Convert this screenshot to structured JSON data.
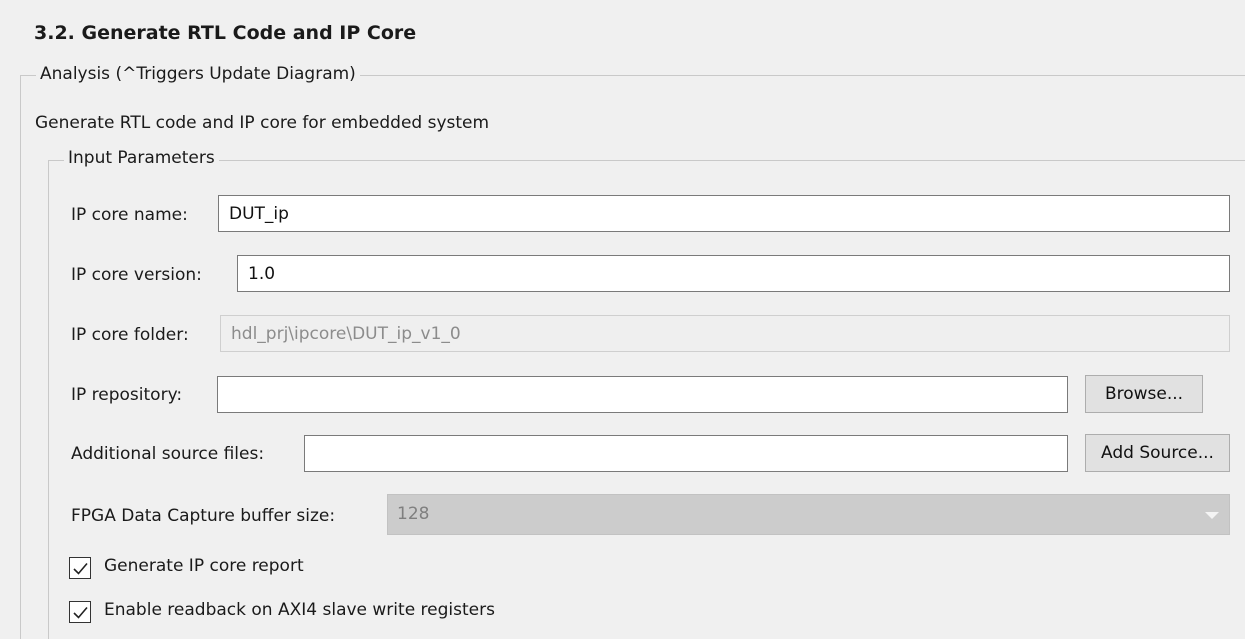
{
  "header": {
    "title": "3.2. Generate RTL Code and IP Core"
  },
  "analysis": {
    "legend": "Analysis (^Triggers Update Diagram)",
    "description": "Generate RTL code and IP core for embedded system"
  },
  "input_parameters": {
    "legend": "Input Parameters",
    "ip_core_name": {
      "label": "IP core name:",
      "value": "DUT_ip"
    },
    "ip_core_version": {
      "label": "IP core version:",
      "value": "1.0"
    },
    "ip_core_folder": {
      "label": "IP core folder:",
      "value": "hdl_prj\\ipcore\\DUT_ip_v1_0"
    },
    "ip_repository": {
      "label": "IP repository:",
      "value": "",
      "button_label": "Browse..."
    },
    "additional_source_files": {
      "label": "Additional source files:",
      "value": "",
      "button_label": "Add Source..."
    },
    "fpga_buffer_size": {
      "label": "FPGA Data Capture buffer size:",
      "selected": "128"
    },
    "generate_report": {
      "label": "Generate IP core report",
      "checked": true
    },
    "enable_readback": {
      "label": "Enable readback on AXI4 slave write registers",
      "checked": true
    }
  }
}
